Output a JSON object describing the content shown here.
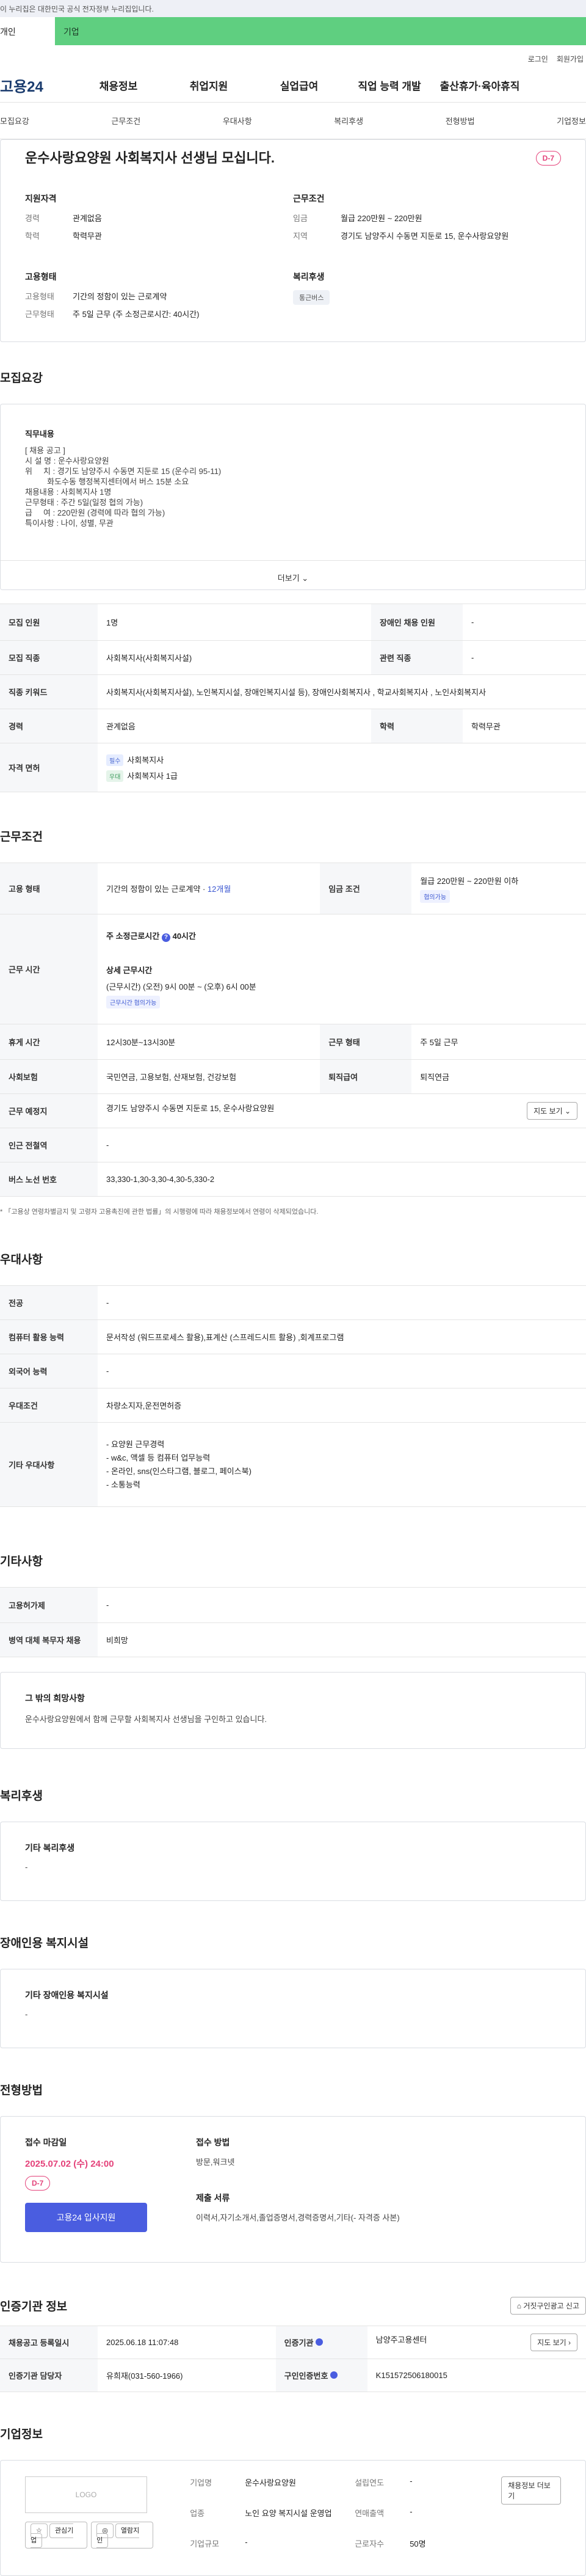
{
  "banner": {
    "text": "이 누리집은 대한민국 공식 전자정부 누리집입니다."
  },
  "tabs": {
    "personal": "개인",
    "company": "기업"
  },
  "util": {
    "login": "로그인",
    "signup": "회원가입"
  },
  "gnb": {
    "logo": "고용24",
    "items": [
      "채용정보",
      "취업지원",
      "실업급여",
      "직업 능력 개발",
      "출산휴가·육아휴직"
    ]
  },
  "anchors": [
    "모집요강",
    "근무조건",
    "우대사항",
    "복리후생",
    "전형방법",
    "기업정보"
  ],
  "summary": {
    "title": "운수사랑요양원 사회복지사 선생님 모십니다.",
    "dday": "D-7",
    "qual_label": "지원자격",
    "career_k": "경력",
    "career_v": "관계없음",
    "edu_k": "학력",
    "edu_v": "학력무관",
    "cond_label": "근무조건",
    "pay_k": "임금",
    "pay_v": "월급 220만원 ~ 220만원",
    "loc_k": "지역",
    "loc_v": "경기도 남양주시 수동면 지둔로 15, 운수사랑요양원",
    "emp_label": "고용형태",
    "type_k": "고용형태",
    "type_v": "기간의 정함이 있는 근로계약",
    "shift_k": "근무형태",
    "shift_v": "주 5일 근무 (주 소정근로시간: 40시간)",
    "welfare_label": "복리후생",
    "welfare_chip": "통근버스"
  },
  "recruit": {
    "title": "모집요강",
    "sub": "직무내용",
    "lines": [
      "[ 채용 공고 ]",
      "",
      "시 설 명 : 운수사랑요양원",
      "위     치 : 경기도 남양주시 수동면 지둔로 15 (운수리 95-11)",
      "          화도수동 행정복지센터에서 버스 15분 소요",
      "채용내용 : 사회복지사 1명",
      "근무형태 : 주간 5일(일정 협의 가능)",
      "급     여 : 220만원 (경력에 따라 협의 가능)",
      "특이사항 : 나이, 성별, 무관"
    ],
    "more": "더보기"
  },
  "recruit_table": {
    "count_k": "모집 인원",
    "count_v": "1명",
    "disabled_k": "장애인 채용 인원",
    "disabled_v": "-",
    "job_k": "모집 직종",
    "job_v": "사회복지사(사회복지사설)",
    "related_k": "관련 직종",
    "related_v": "-",
    "kw_k": "직종 키워드",
    "kw_v": "사회복지사(사회복지사설), 노인복지시설, 장애인복지시설 등), 장애인사회복지사 , 학교사회복지사 , 노인사회복지사",
    "career_k": "경력",
    "career_v": "관계없음",
    "edu_k": "학력",
    "edu_v": "학력무관",
    "license_k": "자격 면허",
    "lic1_tag": "필수",
    "lic1": "사회복지사",
    "lic2_tag": "우대",
    "lic2": "사회복지사 1급"
  },
  "work": {
    "title": "근무조건",
    "type_k": "고용 형태",
    "type_v": "기간의 정함이 있는 근로계약 · ",
    "type_link": "12개월",
    "pay_k": "임금 조건",
    "pay_v": "월급 220만원 ~ 220만원 이하",
    "pay_chip": "협의가능",
    "hours_k": "근무 시간",
    "hours_total": "주 소정근로시간",
    "hours_v": "40시간",
    "detail_title": "상세 근무시간",
    "detail_v": "(근무시간) (오전) 9시 00분 ~ (오후) 6시 00분",
    "detail_chip": "근무시간 협의가능",
    "rest_k": "휴게 시간",
    "rest_v": "12시30분~13시30분",
    "form_k": "근무 형태",
    "form_v": "주 5일 근무",
    "ins_k": "사회보험",
    "ins_v": "국민연금, 고용보험, 산재보험, 건강보험",
    "retire_k": "퇴직급여",
    "retire_v": "퇴직연금",
    "place_k": "근무 예정지",
    "place_v": "경기도 남양주시 수동면 지둔로 15, 운수사랑요양원",
    "map_btn": "지도 보기",
    "station_k": "인근 전철역",
    "station_v": "-",
    "bus_k": "버스 노선 번호",
    "bus_v": "33,330-1,30-3,30-4,30-5,330-2",
    "note": "* 「고용상 연령차별금지 및 고령자 고용촉진에 관한 법률」의 시행령에 따라 채용정보에서 연령이 삭제되었습니다."
  },
  "pref": {
    "title": "우대사항",
    "major_k": "전공",
    "major_v": "-",
    "pc_k": "컴퓨터 활용 능력",
    "pc_v": "문서작성 (워드프로세스 활용),표계산 (스프레드시트 활용) ,회계프로그램",
    "lang_k": "외국어 능력",
    "lang_v": "-",
    "cond_k": "우대조건",
    "cond_v": "차량소지자,운전면허증",
    "etc_k": "기타 우대사항",
    "etc_list": [
      "- 요양원 근무경력",
      "- w&c, 액셀 등 컴퓨터 업무능력",
      "- 온라인, sns(인스타그램, 블로그, 페이스북)",
      "- 소통능력"
    ]
  },
  "other": {
    "title": "기타사항",
    "emp_k": "고용허가제",
    "emp_v": "-",
    "mil_k": "병역 대체 복무자 채용",
    "mil_v": "비희망",
    "hope_title": "그 밖의 희망사항",
    "hope_v": "운수사랑요양원에서 함께 근무할 사회복지사 선생님을 구인하고 있습니다."
  },
  "welfare": {
    "title": "복리후생",
    "sub": "기타 복리후생",
    "v": "-"
  },
  "disabled": {
    "title": "장애인용 복지시설",
    "sub": "기타 장애인용 복지시설",
    "v": "-"
  },
  "process": {
    "title": "전형방법",
    "deadline_label": "접수 마감일",
    "deadline_v": "2025.07.02 (수) 24:00",
    "dday": "D-7",
    "apply_btn": "고용24 입사지원",
    "method_label": "접수 방법",
    "method_v": "방문,워크넷",
    "docs_label": "제출 서류",
    "docs_v": "이력서,자기소개서,졸업증명서,경력증명서,기타(- 자격증 사본)"
  },
  "agency": {
    "title": "인증기관 정보",
    "report_btn": "거짓구인광고 신고",
    "reg_k": "채용공고 등록일시",
    "reg_v": "2025.06.18 11:07:48",
    "org_k": "인증기관",
    "org_v": "남양주고용센터",
    "map_btn": "지도 보기",
    "mgr_k": "인증기관 담당자",
    "mgr_v": "유희재(031-560-1966)",
    "no_k": "구인인증번호",
    "no_v": "K151572506180015"
  },
  "company": {
    "title": "기업정보",
    "logo": "LOGO",
    "fav_btn": "관심기업",
    "follow_btn": "열람지인",
    "name_k": "기업명",
    "name_v": "운수사랑요양원",
    "ind_k": "업종",
    "ind_v": "노인 요양 복지시설 운영업",
    "scale_k": "기업규모",
    "scale_v": "-",
    "est_k": "설립연도",
    "est_v": "-",
    "sales_k": "연매출액",
    "sales_v": "-",
    "staff_k": "근로자수",
    "staff_v": "50명",
    "list_btn": "채용정보 더보기"
  }
}
